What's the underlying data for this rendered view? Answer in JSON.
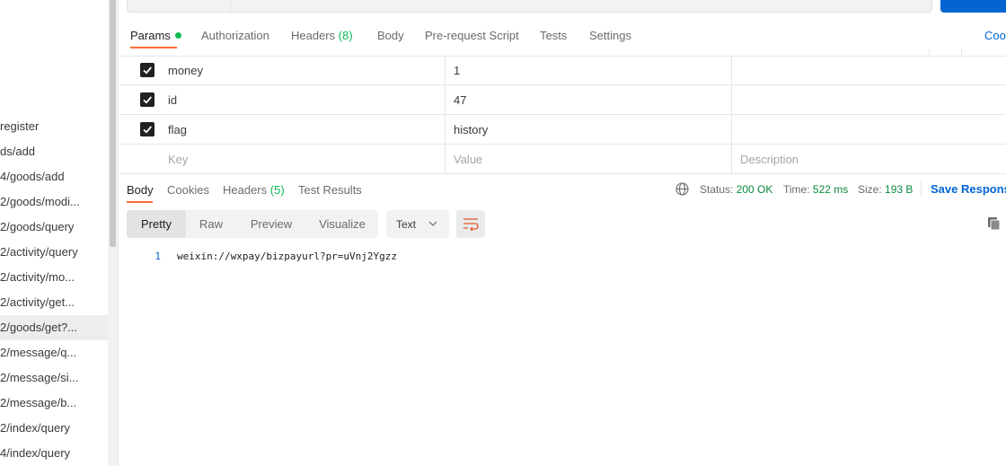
{
  "sidebar": {
    "items": [
      {
        "label": "register",
        "active": false
      },
      {
        "label": "ds/add",
        "active": false
      },
      {
        "label": "4/goods/add",
        "active": false
      },
      {
        "label": "2/goods/modi...",
        "active": false
      },
      {
        "label": "2/goods/query",
        "active": false
      },
      {
        "label": "2/activity/query",
        "active": false
      },
      {
        "label": "2/activity/mo...",
        "active": false
      },
      {
        "label": "2/activity/get...",
        "active": false
      },
      {
        "label": "2/goods/get?...",
        "active": true
      },
      {
        "label": "2/message/q...",
        "active": false
      },
      {
        "label": "2/message/si...",
        "active": false
      },
      {
        "label": "2/message/b...",
        "active": false
      },
      {
        "label": "2/index/query",
        "active": false
      },
      {
        "label": "4/index/query",
        "active": false
      }
    ]
  },
  "request_tabs": {
    "params": "Params",
    "authorization": "Authorization",
    "headers": "Headers",
    "headers_count": "(8)",
    "body": "Body",
    "prerequest": "Pre-request Script",
    "tests": "Tests",
    "settings": "Settings",
    "cookies": "Coo"
  },
  "params": {
    "rows": [
      {
        "key": "money",
        "value": "1",
        "description": "",
        "checked": true
      },
      {
        "key": "id",
        "value": "47",
        "description": "",
        "checked": true
      },
      {
        "key": "flag",
        "value": "history",
        "description": "",
        "checked": true
      }
    ],
    "placeholder": {
      "key": "Key",
      "value": "Value",
      "description": "Description"
    }
  },
  "response": {
    "tabs": {
      "body": "Body",
      "cookies": "Cookies",
      "headers": "Headers",
      "headers_count": "(5)",
      "test_results": "Test Results"
    },
    "status_label": "Status:",
    "status_value": "200 OK",
    "time_label": "Time:",
    "time_value": "522 ms",
    "size_label": "Size:",
    "size_value": "193 B",
    "save_response": "Save Respons",
    "format": {
      "pretty": "Pretty",
      "raw": "Raw",
      "preview": "Preview",
      "visualize": "Visualize",
      "type": "Text"
    },
    "lines": [
      {
        "no": "1",
        "text": "weixin://wxpay/bizpayurl?pr=uVnj2Ygzz"
      }
    ]
  },
  "colors": {
    "accent": "#ff6c37",
    "link": "#0265d2",
    "success": "#0cbb52"
  },
  "icons": [
    "checkbox-icon",
    "globe-icon",
    "chevron-down-icon",
    "wrap-lines-icon",
    "copy-icon"
  ]
}
